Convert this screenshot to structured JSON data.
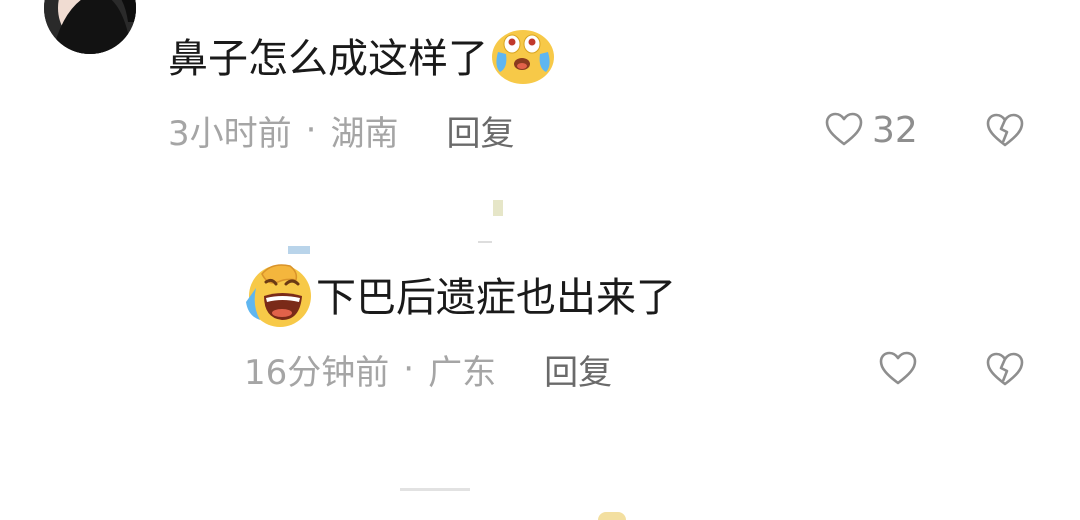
{
  "comments": [
    {
      "text": "鼻子怎么成这样了",
      "emoji": "crying-emoji",
      "time": "3小时前",
      "location": "湖南",
      "reply_label": "回复",
      "likes": "32"
    },
    {
      "text": "下巴后遗症也出来了",
      "emoji": "laughing-crying-emoji",
      "time": "16分钟前",
      "location": "广东",
      "reply_label": "回复",
      "likes": ""
    }
  ],
  "separator": "·",
  "colors": {
    "text": "#1a1a1a",
    "meta": "#a5a5a5",
    "icon": "#8e8e8e",
    "emoji_face": "#f7c948"
  }
}
